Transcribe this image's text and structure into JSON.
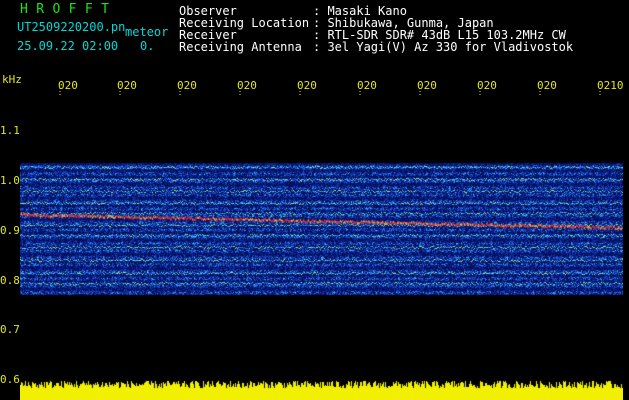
{
  "header": {
    "app_title": "HROFFT",
    "filename": "UT2509220200.pn",
    "type_label": "meteor",
    "date_time": "25.09.22 02:00",
    "count": "0."
  },
  "info": {
    "rows": [
      {
        "label": "Observer",
        "value": ": Masaki Kano"
      },
      {
        "label": "Receiving Location",
        "value": ": Shibukawa, Gunma, Japan"
      },
      {
        "label": "Receiver",
        "value": ": RTL-SDR SDR# 43dB L15 103.2MHz CW"
      },
      {
        "label": "Receiving Antenna",
        "value": ": 3el Yagi(V) Az 330 for Vladivostok"
      }
    ]
  },
  "axis": {
    "unit": "kHz",
    "y_ticks": [
      "1.1",
      "1.0",
      "0.9",
      "0.8",
      "0.7",
      "0.6"
    ],
    "x_ticks": [
      "020",
      "020",
      "020",
      "020",
      "020",
      "020",
      "020",
      "020",
      "020",
      "0210"
    ]
  },
  "colors": {
    "background": "#000000",
    "label_green": "#19e619",
    "label_cyan": "#00d8d8",
    "tick_yellow": "#e6e61a",
    "signal_red": "#e23030",
    "power_bar": "#f0f000"
  },
  "icons": {
    "tick_marks": "dotted-tick-marks"
  }
}
